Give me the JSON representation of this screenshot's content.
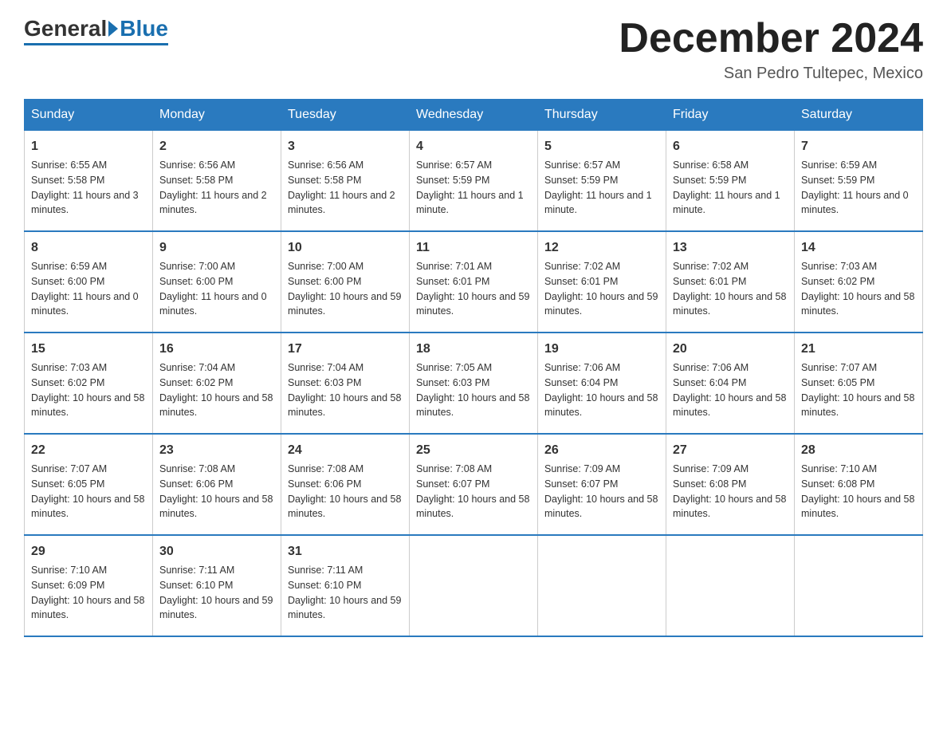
{
  "header": {
    "logo_general": "General",
    "logo_blue": "Blue",
    "month_title": "December 2024",
    "location": "San Pedro Tultepec, Mexico"
  },
  "days_of_week": [
    "Sunday",
    "Monday",
    "Tuesday",
    "Wednesday",
    "Thursday",
    "Friday",
    "Saturday"
  ],
  "weeks": [
    [
      {
        "day": "1",
        "sunrise": "6:55 AM",
        "sunset": "5:58 PM",
        "daylight": "11 hours and 3 minutes."
      },
      {
        "day": "2",
        "sunrise": "6:56 AM",
        "sunset": "5:58 PM",
        "daylight": "11 hours and 2 minutes."
      },
      {
        "day": "3",
        "sunrise": "6:56 AM",
        "sunset": "5:58 PM",
        "daylight": "11 hours and 2 minutes."
      },
      {
        "day": "4",
        "sunrise": "6:57 AM",
        "sunset": "5:59 PM",
        "daylight": "11 hours and 1 minute."
      },
      {
        "day": "5",
        "sunrise": "6:57 AM",
        "sunset": "5:59 PM",
        "daylight": "11 hours and 1 minute."
      },
      {
        "day": "6",
        "sunrise": "6:58 AM",
        "sunset": "5:59 PM",
        "daylight": "11 hours and 1 minute."
      },
      {
        "day": "7",
        "sunrise": "6:59 AM",
        "sunset": "5:59 PM",
        "daylight": "11 hours and 0 minutes."
      }
    ],
    [
      {
        "day": "8",
        "sunrise": "6:59 AM",
        "sunset": "6:00 PM",
        "daylight": "11 hours and 0 minutes."
      },
      {
        "day": "9",
        "sunrise": "7:00 AM",
        "sunset": "6:00 PM",
        "daylight": "11 hours and 0 minutes."
      },
      {
        "day": "10",
        "sunrise": "7:00 AM",
        "sunset": "6:00 PM",
        "daylight": "10 hours and 59 minutes."
      },
      {
        "day": "11",
        "sunrise": "7:01 AM",
        "sunset": "6:01 PM",
        "daylight": "10 hours and 59 minutes."
      },
      {
        "day": "12",
        "sunrise": "7:02 AM",
        "sunset": "6:01 PM",
        "daylight": "10 hours and 59 minutes."
      },
      {
        "day": "13",
        "sunrise": "7:02 AM",
        "sunset": "6:01 PM",
        "daylight": "10 hours and 58 minutes."
      },
      {
        "day": "14",
        "sunrise": "7:03 AM",
        "sunset": "6:02 PM",
        "daylight": "10 hours and 58 minutes."
      }
    ],
    [
      {
        "day": "15",
        "sunrise": "7:03 AM",
        "sunset": "6:02 PM",
        "daylight": "10 hours and 58 minutes."
      },
      {
        "day": "16",
        "sunrise": "7:04 AM",
        "sunset": "6:02 PM",
        "daylight": "10 hours and 58 minutes."
      },
      {
        "day": "17",
        "sunrise": "7:04 AM",
        "sunset": "6:03 PM",
        "daylight": "10 hours and 58 minutes."
      },
      {
        "day": "18",
        "sunrise": "7:05 AM",
        "sunset": "6:03 PM",
        "daylight": "10 hours and 58 minutes."
      },
      {
        "day": "19",
        "sunrise": "7:06 AM",
        "sunset": "6:04 PM",
        "daylight": "10 hours and 58 minutes."
      },
      {
        "day": "20",
        "sunrise": "7:06 AM",
        "sunset": "6:04 PM",
        "daylight": "10 hours and 58 minutes."
      },
      {
        "day": "21",
        "sunrise": "7:07 AM",
        "sunset": "6:05 PM",
        "daylight": "10 hours and 58 minutes."
      }
    ],
    [
      {
        "day": "22",
        "sunrise": "7:07 AM",
        "sunset": "6:05 PM",
        "daylight": "10 hours and 58 minutes."
      },
      {
        "day": "23",
        "sunrise": "7:08 AM",
        "sunset": "6:06 PM",
        "daylight": "10 hours and 58 minutes."
      },
      {
        "day": "24",
        "sunrise": "7:08 AM",
        "sunset": "6:06 PM",
        "daylight": "10 hours and 58 minutes."
      },
      {
        "day": "25",
        "sunrise": "7:08 AM",
        "sunset": "6:07 PM",
        "daylight": "10 hours and 58 minutes."
      },
      {
        "day": "26",
        "sunrise": "7:09 AM",
        "sunset": "6:07 PM",
        "daylight": "10 hours and 58 minutes."
      },
      {
        "day": "27",
        "sunrise": "7:09 AM",
        "sunset": "6:08 PM",
        "daylight": "10 hours and 58 minutes."
      },
      {
        "day": "28",
        "sunrise": "7:10 AM",
        "sunset": "6:08 PM",
        "daylight": "10 hours and 58 minutes."
      }
    ],
    [
      {
        "day": "29",
        "sunrise": "7:10 AM",
        "sunset": "6:09 PM",
        "daylight": "10 hours and 58 minutes."
      },
      {
        "day": "30",
        "sunrise": "7:11 AM",
        "sunset": "6:10 PM",
        "daylight": "10 hours and 59 minutes."
      },
      {
        "day": "31",
        "sunrise": "7:11 AM",
        "sunset": "6:10 PM",
        "daylight": "10 hours and 59 minutes."
      },
      {
        "day": "",
        "sunrise": "",
        "sunset": "",
        "daylight": ""
      },
      {
        "day": "",
        "sunrise": "",
        "sunset": "",
        "daylight": ""
      },
      {
        "day": "",
        "sunrise": "",
        "sunset": "",
        "daylight": ""
      },
      {
        "day": "",
        "sunrise": "",
        "sunset": "",
        "daylight": ""
      }
    ]
  ]
}
